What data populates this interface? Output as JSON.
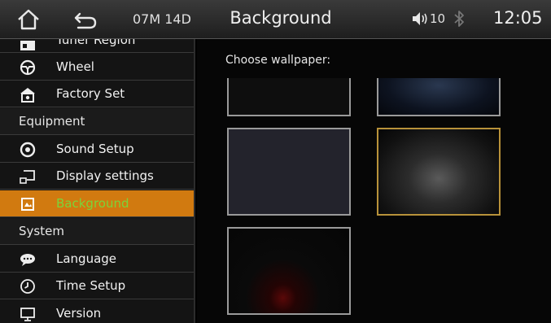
{
  "header": {
    "date": "07M 14D",
    "title": "Background",
    "volume": "10",
    "clock": "12:05"
  },
  "sidebar": {
    "items": [
      {
        "label": "Tuner Region",
        "type": "item",
        "icon": "radio-icon"
      },
      {
        "label": "Wheel",
        "type": "item",
        "icon": "steering-wheel-icon"
      },
      {
        "label": "Factory Set",
        "type": "item",
        "icon": "factory-icon"
      },
      {
        "label": "Equipment",
        "type": "section"
      },
      {
        "label": "Sound Setup",
        "type": "item",
        "icon": "speaker-icon"
      },
      {
        "label": "Display settings",
        "type": "item",
        "icon": "display-icon"
      },
      {
        "label": "Background",
        "type": "item",
        "icon": "wallpaper-icon",
        "active": true
      },
      {
        "label": "System",
        "type": "section"
      },
      {
        "label": "Language",
        "type": "item",
        "icon": "speech-bubble-icon"
      },
      {
        "label": "Time Setup",
        "type": "item",
        "icon": "clock-icon"
      },
      {
        "label": "Version",
        "type": "item",
        "icon": "monitor-icon"
      }
    ]
  },
  "main": {
    "choose_label": "Choose wallpaper:",
    "wallpapers": [
      {
        "name": "black"
      },
      {
        "name": "blue-glow"
      },
      {
        "name": "slate"
      },
      {
        "name": "grey-spotlight",
        "selected": true
      },
      {
        "name": "red-flame"
      }
    ]
  },
  "colors": {
    "active_row": "#d17a10",
    "active_text": "#7bd43a",
    "selected_border": "#b8923a"
  }
}
